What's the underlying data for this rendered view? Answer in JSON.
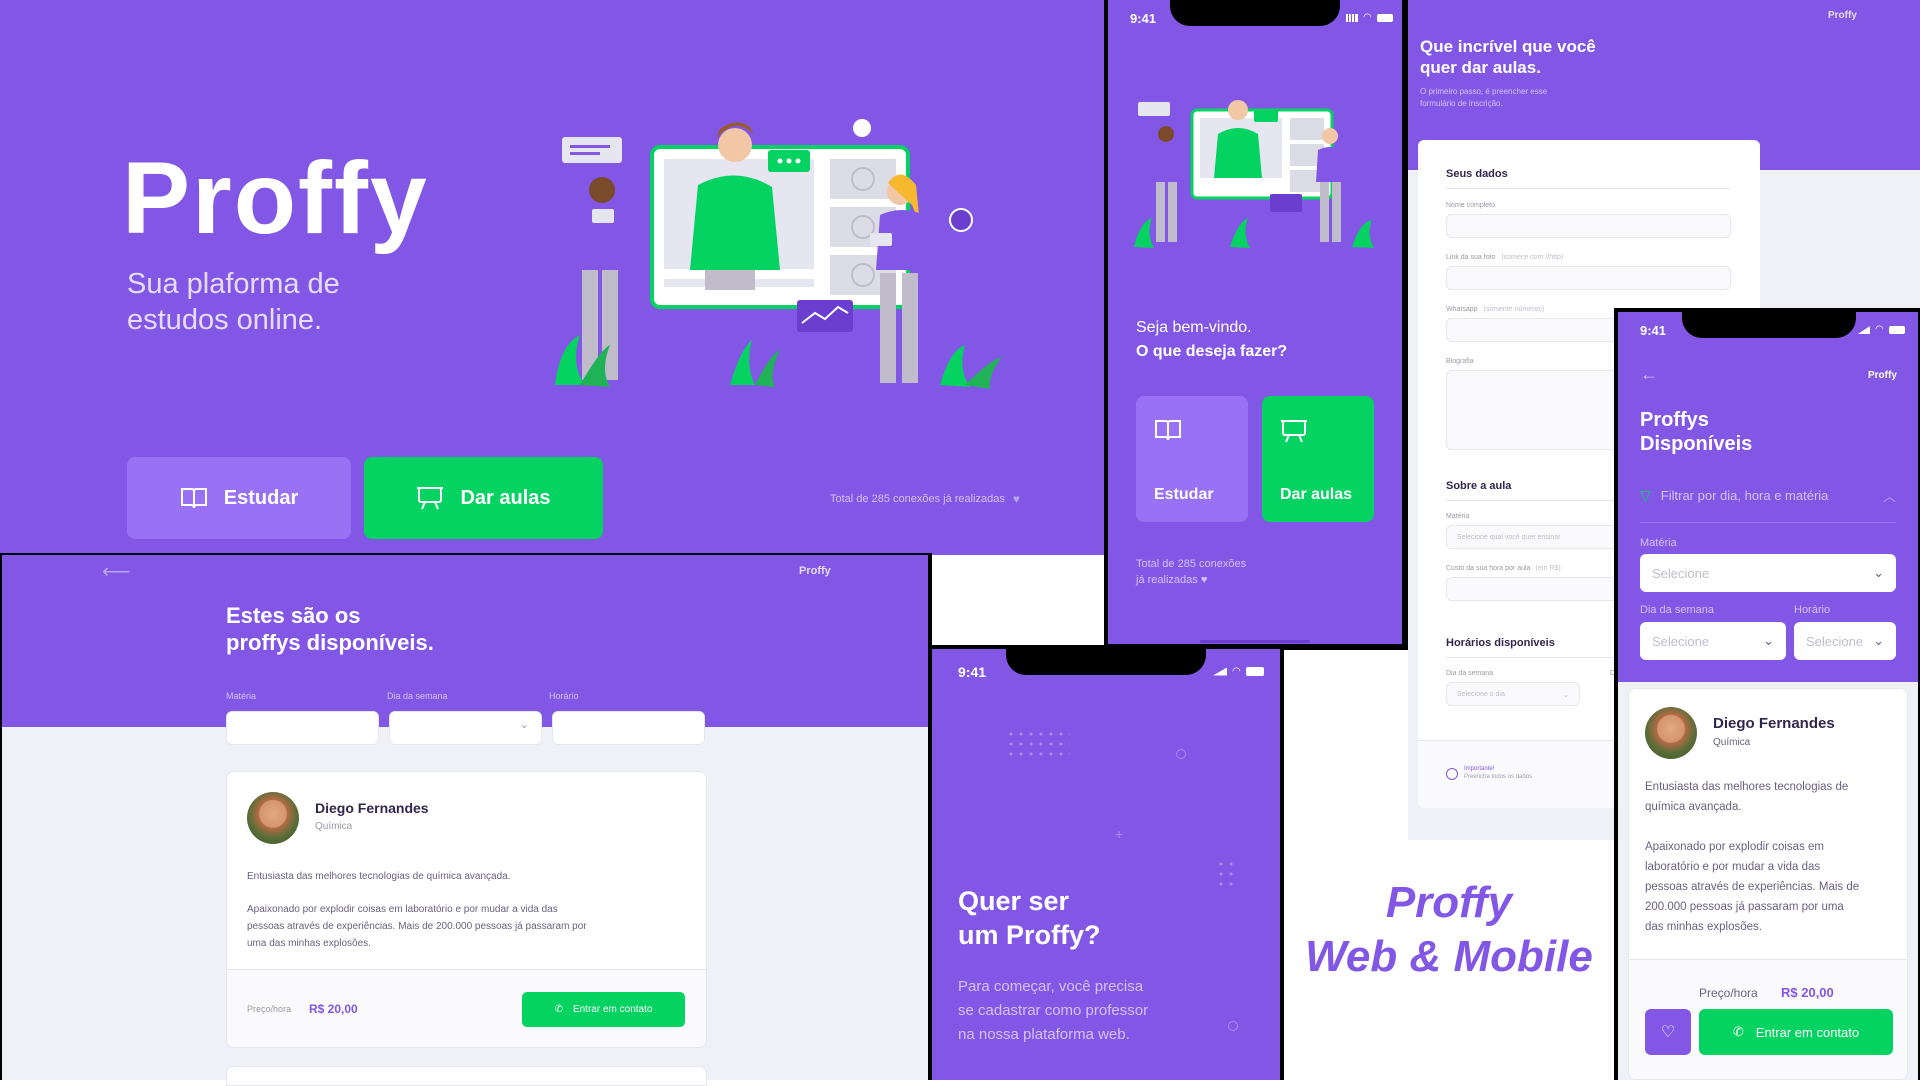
{
  "landing": {
    "logo": "Proffy",
    "tagline_line1": "Sua plaforma de",
    "tagline_line2": "estudos online.",
    "study_label": "Estudar",
    "teach_label": "Dar aulas",
    "connections": "Total de 285 conexões já realizadas"
  },
  "mobile_home": {
    "time": "9:41",
    "welcome": "Seja bem-vindo.",
    "question": "O que deseja fazer?",
    "study_label": "Estudar",
    "teach_label": "Dar aulas",
    "connections_line1": "Total de 285 conexões",
    "connections_line2": "já realizadas"
  },
  "form_page": {
    "logo": "Proffy",
    "title_line1": "Que incrível que você",
    "title_line2": "quer dar aulas.",
    "subtitle_line1": "O primeiro passo, é preencher esse",
    "subtitle_line2": "formulário de inscrição.",
    "section_data": "Seus dados",
    "label_name": "Nome completo",
    "label_avatar": "Link da sua foto",
    "label_avatar_hint": "(comece com //http)",
    "label_whatsapp": "Whatsapp",
    "label_whatsapp_hint": "(somente números)",
    "label_bio": "Biografia",
    "section_class": "Sobre a aula",
    "label_subject": "Matéria",
    "subject_placeholder": "Selecione qual você quer ensinar",
    "label_cost": "Custo da sua hora por aula",
    "label_cost_hint": "(em R$)",
    "section_schedule": "Horários disponíveis",
    "label_weekday": "Dia da semana",
    "label_weekday_short": "Da",
    "weekday_placeholder": "Selecione o dia",
    "warning_title": "Importante!",
    "warning_text": "Preencha todos os dados"
  },
  "list_page": {
    "logo": "Proffy",
    "title_line1": "Estes são os",
    "title_line2": "proffys disponíveis.",
    "filter_subject": "Matéria",
    "filter_weekday": "Dia da semana",
    "filter_time": "Horário",
    "teacher_name": "Diego Fernandes",
    "teacher_subject": "Química",
    "bio1": "Entusiasta das melhores tecnologias de química avançada.",
    "bio2_line1": "Apaixonado por explodir coisas em laboratório e por mudar a vida das",
    "bio2_line2": "pessoas através de experiências. Mais de 200.000 pessoas já passaram por",
    "bio2_line3": "uma das minhas explosões.",
    "price_label": "Preço/hora",
    "price_value": "R$ 20,00",
    "contact_label": "Entrar em contato"
  },
  "mobile_give": {
    "time": "9:41",
    "title_line1": "Quer ser",
    "title_line2": "um Proffy?",
    "text_line1": "Para começar, você precisa",
    "text_line2": "se cadastrar como professor",
    "text_line3": "na nossa plataforma web."
  },
  "mobile_list": {
    "time": "9:41",
    "logo": "Proffy",
    "title_line1": "Proffys",
    "title_line2": "Disponíveis",
    "filter_label": "Filtrar por dia, hora e matéria",
    "label_subject": "Matéria",
    "label_weekday": "Dia da semana",
    "label_time": "Horário",
    "select_placeholder": "Selecione",
    "teacher_name": "Diego Fernandes",
    "teacher_subject": "Química",
    "bio1_line1": "Entusiasta das melhores tecnologias de",
    "bio1_line2": "química avançada.",
    "bio2_line1": "Apaixonado por explodir coisas em",
    "bio2_line2": "laboratório e por mudar a vida das",
    "bio2_line3": "pessoas através de experiências. Mais de",
    "bio2_line4": "200.000 pessoas já passaram por uma",
    "bio2_line5": "das minhas explosões.",
    "price_label": "Preço/hora",
    "price_value": "R$ 20,00",
    "contact_label": "Entrar em contato"
  },
  "caption": {
    "line1": "Proffy",
    "line2": "Web & Mobile"
  },
  "colors": {
    "primary": "#8257e5",
    "primary_light": "#9871f5",
    "secondary": "#04d361",
    "background": "#f0f0f7",
    "caption": "#8257e5"
  }
}
